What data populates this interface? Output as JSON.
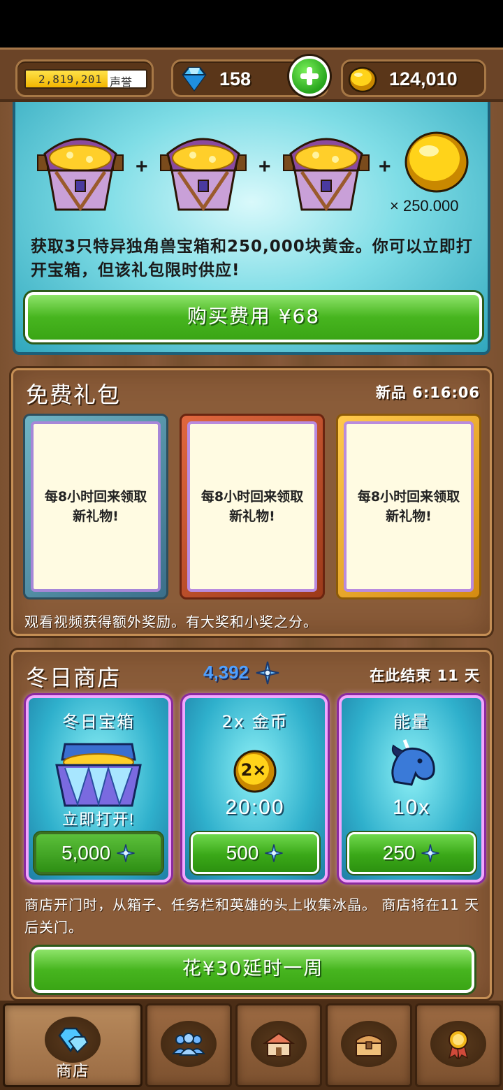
{
  "topbar": {
    "reputation_value": "2,819,201",
    "reputation_label": "声誉",
    "reputation_progress": 0.68,
    "gems": "158",
    "gold": "124,010"
  },
  "offer": {
    "coin_amount": "× 250.000",
    "description": "获取3只特异独角兽宝箱和250,000块黄金。你可以立即打开宝箱，但该礼包限时供应!",
    "buy_label": "购买费用 ¥68"
  },
  "free_gifts": {
    "title": "免费礼包",
    "timer": "新品 6:16:06",
    "cards": [
      {
        "text": "每8小时回来领取新礼物!"
      },
      {
        "text": "每8小时回来领取新礼物!"
      },
      {
        "text": "每8小时回来领取新礼物!"
      }
    ],
    "note": "观看视频获得额外奖励。有大奖和小奖之分。"
  },
  "winter_shop": {
    "title": "冬日商店",
    "crystals": "4,392",
    "ends": "在此结束 11 天",
    "items": [
      {
        "title": "冬日宝箱",
        "sub": "立即打开!",
        "price": "5,000"
      },
      {
        "title": "2x 金币",
        "sub": "20:00",
        "price": "500"
      },
      {
        "title": "能量",
        "sub": "10x",
        "price": "250"
      }
    ],
    "note": "商店开门时，从箱子、任务栏和英雄的头上收集冰晶。 商店将在11 天后关门。",
    "extend_label": "花¥30延时一周"
  },
  "nav": {
    "tabs": [
      {
        "label": "商店",
        "icon": "diamond-icon",
        "active": true
      },
      {
        "label": "",
        "icon": "heroes-icon",
        "active": false
      },
      {
        "label": "",
        "icon": "town-icon",
        "active": false
      },
      {
        "label": "",
        "icon": "chest-icon",
        "active": false
      },
      {
        "label": "",
        "icon": "medal-icon",
        "active": false
      }
    ]
  },
  "colors": {
    "green_button": "#47b51f",
    "wood": "#8a5c39",
    "crystal_blue": "#4fa0ff",
    "card_border": "#f2a6ff"
  }
}
